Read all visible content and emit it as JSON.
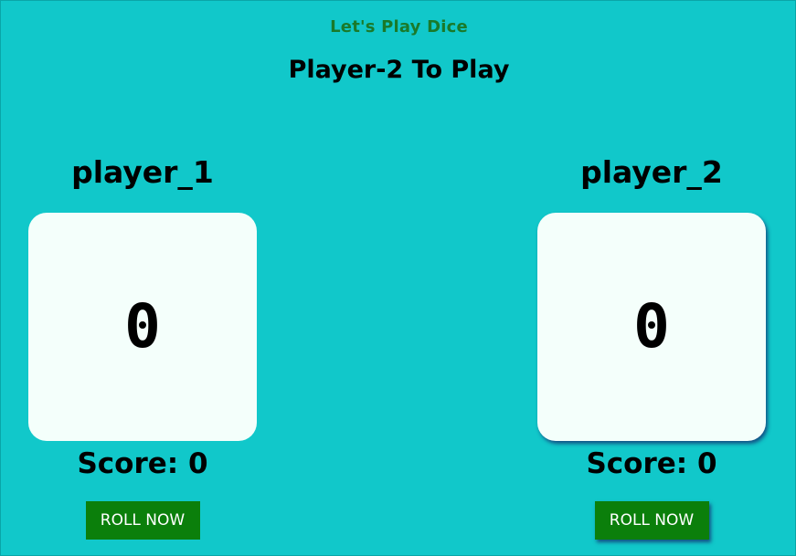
{
  "header": {
    "app_title": "Let's Play Dice",
    "turn_status": "Player-2 To Play"
  },
  "players": [
    {
      "name": "player_1",
      "dice_value": "0",
      "score_text": "Score: 0",
      "button_label": "ROLL NOW",
      "active": false
    },
    {
      "name": "player_2",
      "dice_value": "0",
      "score_text": "Score: 0",
      "button_label": "ROLL NOW",
      "active": true
    }
  ],
  "colors": {
    "background": "#11c8ca",
    "title": "#1a7a2a",
    "dice_box": "#f4fffb",
    "button": "#0b7f0b"
  }
}
